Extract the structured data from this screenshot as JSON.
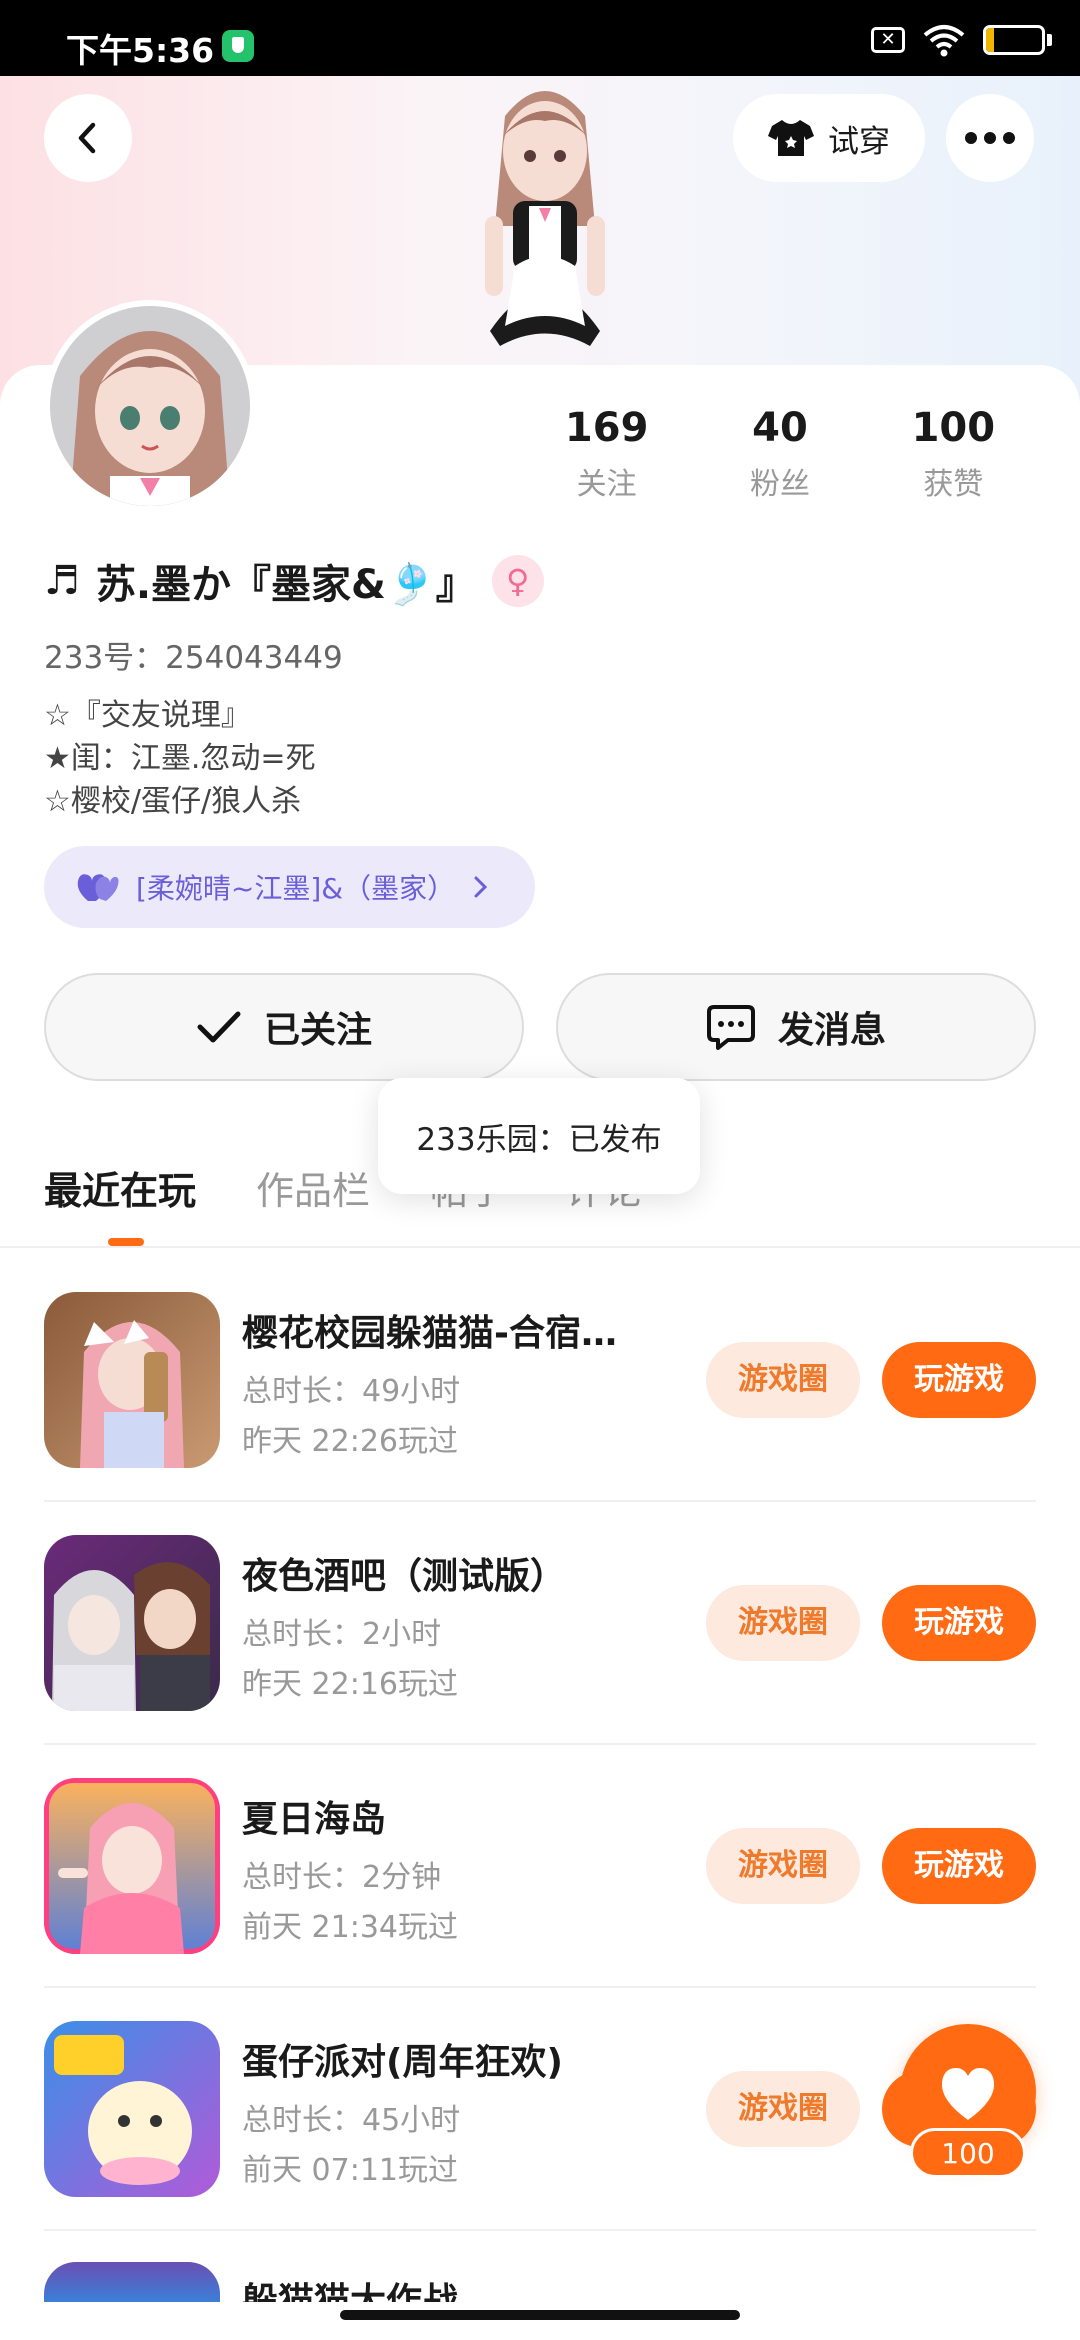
{
  "status_bar": {
    "time": "下午5:36",
    "battery": "14",
    "battery_fraction": 0.14,
    "sim_icon": "no-sim-icon"
  },
  "header": {
    "try_on_label": "试穿"
  },
  "profile": {
    "stats": [
      {
        "value": "169",
        "label": "关注"
      },
      {
        "value": "40",
        "label": "粉丝"
      },
      {
        "value": "100",
        "label": "获赞"
      }
    ],
    "name_prefix": "♬",
    "name": "苏.墨か『墨家&🎐』",
    "gender_symbol": "♀",
    "uid": "233号：254043449",
    "bio": [
      "☆『交友说理』",
      "★闺：江墨.忽动=死",
      "☆樱校/蛋仔/狼人杀"
    ],
    "team": "[柔婉晴~江墨]&（墨家）"
  },
  "actions": {
    "follow_label": "已关注",
    "message_label": "发消息"
  },
  "toast": "233乐园：已发布",
  "tabs": [
    "最近在玩",
    "作品栏",
    "帖子",
    "评论"
  ],
  "games": [
    {
      "title": "樱花校园躲猫猫-合宿…",
      "duration": "总时长：49小时",
      "last_played": "昨天 22:26玩过",
      "circle_label": "游戏圈",
      "play_label": "玩游戏"
    },
    {
      "title": "夜色酒吧（测试版）",
      "duration": "总时长：2小时",
      "last_played": "昨天 22:16玩过",
      "circle_label": "游戏圈",
      "play_label": "玩游戏"
    },
    {
      "title": "夏日海岛",
      "duration": "总时长：2分钟",
      "last_played": "前天 21:34玩过",
      "circle_label": "游戏圈",
      "play_label": "玩游戏"
    },
    {
      "title": "蛋仔派对(周年狂欢)",
      "duration": "总时长：45小时",
      "last_played": "前天 07:11玩过",
      "circle_label": "游戏圈",
      "play_label": "玩游戏"
    }
  ],
  "partial_game_title": "躲猫猫大作战",
  "like_fab": {
    "count": "100"
  },
  "colors": {
    "accent": "#ff6a13",
    "accent_light": "#fde9dd",
    "team_bg": "#ece9fb",
    "team_text": "#6a5fd9"
  }
}
